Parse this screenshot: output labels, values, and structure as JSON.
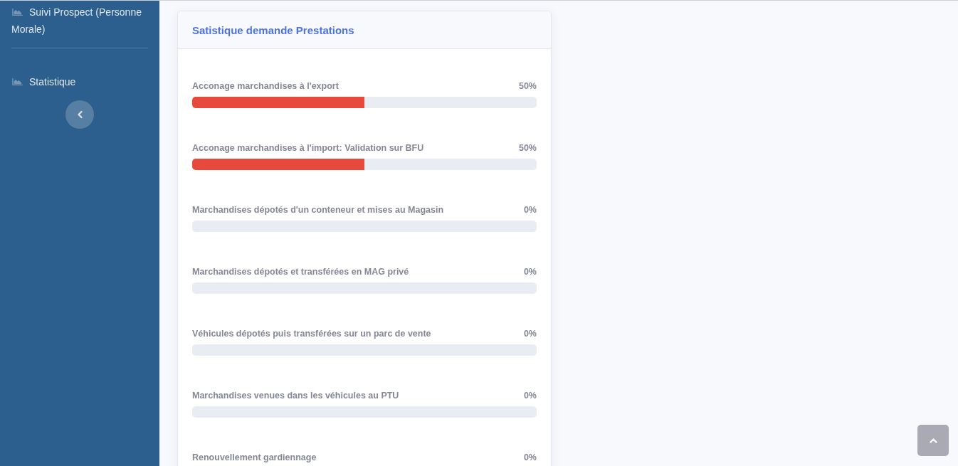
{
  "sidebar": {
    "sections": [
      {
        "items": [
          {
            "label": "Suivi Prospect (Personne Morale)"
          }
        ]
      },
      {
        "items": [
          {
            "label": "Statistique"
          }
        ]
      }
    ]
  },
  "card": {
    "title": "Satistique demande Prestations",
    "rows": [
      {
        "kind": "bar",
        "label": "Acconage marchandises à l'export",
        "reading": "50%",
        "level": 0.5
      },
      {
        "kind": "bar",
        "label": "Acconage marchandises à l'import: Validation sur BFU",
        "reading": "50%",
        "level": 0.5
      },
      {
        "kind": "bar",
        "label": "Marchandises dépotés d'un conteneur et mises au Magasin",
        "reading": "0%"
      },
      {
        "kind": "bar",
        "label": "Marchandises dépotés et transférées en MAG privé",
        "reading": "0%"
      },
      {
        "kind": "bar",
        "label": "Véhicules dépotés puis transférées sur un parc de vente",
        "reading": "0%"
      },
      {
        "kind": "bar",
        "label": "Marchandises venues dans les véhicules au PTU",
        "reading": "0%"
      },
      {
        "kind": "heading",
        "label": "Renouvellement gardiennage",
        "reading": "0%"
      }
    ]
  }
}
